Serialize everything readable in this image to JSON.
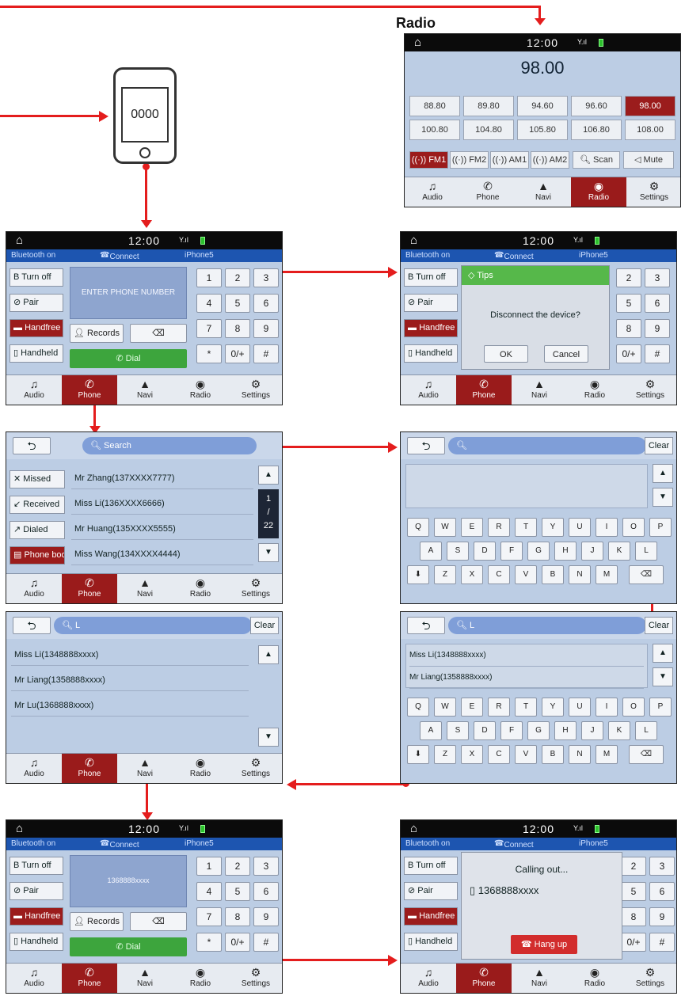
{
  "radio_title": "Radio",
  "clock": "12:00",
  "phone_code": "0000",
  "radio": {
    "frequency": "98.00",
    "presets": [
      "88.80",
      "89.80",
      "94.60",
      "96.60",
      "98.00",
      "100.80",
      "104.80",
      "105.80",
      "106.80",
      "108.00"
    ],
    "active_preset": "98.00",
    "bands": [
      "FM1",
      "FM2",
      "AM1",
      "AM2"
    ],
    "scan": "Scan",
    "mute": "Mute"
  },
  "nav": {
    "audio": "Audio",
    "phone": "Phone",
    "navi": "Navi",
    "radio": "Radio",
    "settings": "Settings"
  },
  "bt": {
    "status": "Bluetooth on",
    "connect": "Connect",
    "device": "iPhone5"
  },
  "side": {
    "turnoff": "Turn off",
    "pair": "Pair",
    "handfree": "Handfree",
    "handheld": "Handheld"
  },
  "dialer": {
    "placeholder": "ENTER PHONE NUMBER",
    "records": "Records",
    "dial": "Dial",
    "keys": [
      "1",
      "2",
      "3",
      "4",
      "5",
      "6",
      "7",
      "8",
      "9",
      "*",
      "0/+",
      "#"
    ],
    "entered": "1368888xxxx"
  },
  "tips": {
    "title": "Tips",
    "message": "Disconnect the device?",
    "ok": "OK",
    "cancel": "Cancel"
  },
  "records": {
    "search": "Search",
    "tabs": [
      "Missed",
      "Received",
      "Dialed",
      "Phone book"
    ],
    "contacts": [
      "Mr Zhang(137XXXX7777)",
      "Miss Li(136XXXX6666)",
      "Mr Huang(135XXXX5555)",
      "Miss Wang(134XXXX4444)"
    ],
    "page_current": "1",
    "page_sep": "/",
    "page_total": "22"
  },
  "keyboard": {
    "clear": "Clear",
    "row1": [
      "Q",
      "W",
      "E",
      "R",
      "T",
      "Y",
      "U",
      "I",
      "O",
      "P"
    ],
    "row2": [
      "A",
      "S",
      "D",
      "F",
      "G",
      "H",
      "J",
      "K",
      "L"
    ],
    "row3": [
      "Z",
      "X",
      "C",
      "V",
      "B",
      "N",
      "M"
    ]
  },
  "search_l": {
    "query": "L",
    "results": [
      "Miss Li(1348888xxxx)",
      "Mr Liang(1358888xxxx)",
      "Mr Lu(1368888xxxx)"
    ],
    "results_short": [
      "Miss Li(1348888xxxx)",
      "Mr Liang(1358888xxxx)"
    ]
  },
  "calling": {
    "status": "Calling out...",
    "number": "1368888xxxx",
    "hangup": "Hang up"
  }
}
